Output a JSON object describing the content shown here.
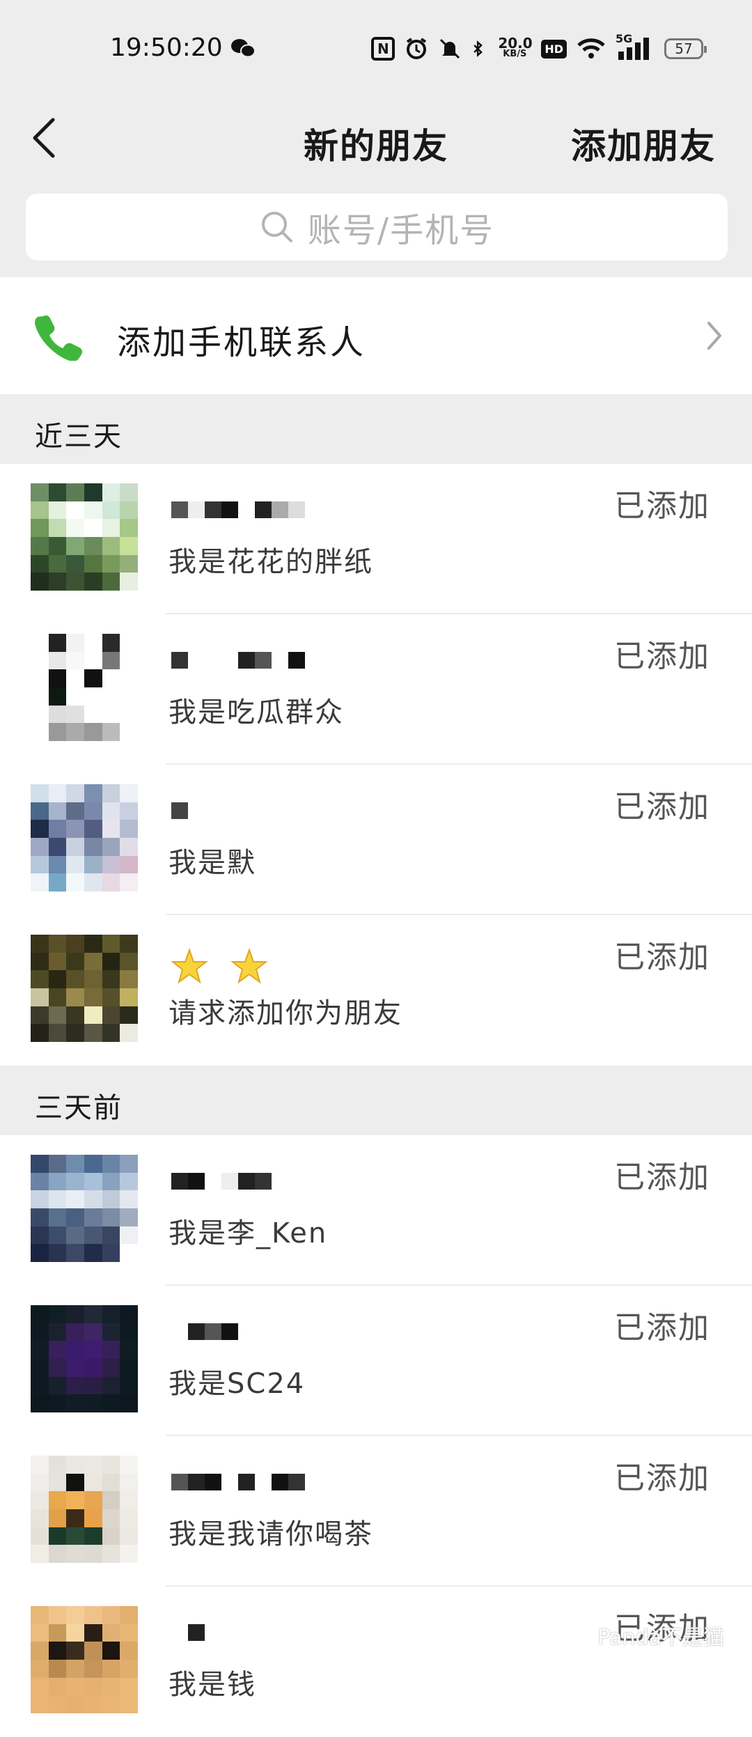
{
  "status_bar": {
    "time": "19:50:20",
    "network_speed_value": "20.0",
    "network_speed_unit": "KB/S",
    "hd": "HD",
    "cellular": "5G",
    "battery": "57"
  },
  "nav": {
    "back_icon": "chevron-left-icon",
    "title": "新的朋友",
    "add_friend": "添加朋友"
  },
  "search": {
    "placeholder": "账号/手机号"
  },
  "add_contacts": {
    "label": "添加手机联系人",
    "icon": "phone-icon"
  },
  "sections": [
    {
      "title": "近三天",
      "items": [
        {
          "message": "我是花花的胖纸",
          "status": "已添加"
        },
        {
          "message": "我是吃瓜群众",
          "status": "已添加"
        },
        {
          "message": "我是默",
          "status": "已添加"
        },
        {
          "message": "请求添加你为朋友",
          "status": "已添加"
        }
      ]
    },
    {
      "title": "三天前",
      "items": [
        {
          "message": "我是李_Ken",
          "status": "已添加"
        },
        {
          "message": "我是SC24",
          "status": "已添加"
        },
        {
          "message": "我是我请你喝茶",
          "status": "已添加"
        },
        {
          "message": "我是钱",
          "status": "已添加"
        }
      ]
    }
  ],
  "watermark": "Panda不是猫",
  "colors": {
    "background": "#ededed",
    "phone_green": "#3fb73c",
    "status_gray": "#555555",
    "placeholder_gray": "#b4b4b4"
  }
}
